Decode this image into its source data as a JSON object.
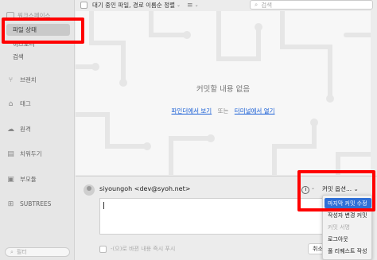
{
  "sidebar": {
    "workspace_label": "워크스페이스",
    "items": [
      {
        "label": "파일 상태",
        "active": true
      },
      {
        "label": "히스토리",
        "active": false
      },
      {
        "label": "검색",
        "active": false
      }
    ],
    "groups": [
      {
        "label": "브랜치",
        "icon": "branch-icon"
      },
      {
        "label": "태그",
        "icon": "tag-icon"
      },
      {
        "label": "원격",
        "icon": "cloud-icon"
      },
      {
        "label": "치워두기",
        "icon": "stash-icon"
      },
      {
        "label": "부모듈",
        "icon": "submodule-icon"
      },
      {
        "label": "SUBTREES",
        "icon": "subtree-icon"
      }
    ],
    "filter_placeholder": "필터"
  },
  "toolbar": {
    "sort_label": "대기 중인 파일, 경로 이름순 정렬",
    "search_placeholder": "검색"
  },
  "main": {
    "empty_title": "커밋할 내용 없음",
    "show_in_finder": "파인더에서 보기",
    "or_text": "또는",
    "open_in_terminal": "터미널에서 열기"
  },
  "commit": {
    "author": "siyoungoh <dev@syoh.net>",
    "message_value": "",
    "commit_options_label": "커밋 옵션...",
    "push_option_label": "-(으)로 바뀐 내용 즉시 푸시",
    "cancel_label": "취소"
  },
  "commit_menu": {
    "items": [
      {
        "label": "마지막 커밋 수정",
        "state": "selected"
      },
      {
        "label": "작성자 변경 커밋",
        "state": "normal"
      },
      {
        "label": "커밋 서명",
        "state": "disabled"
      },
      {
        "label": "로그아웃",
        "state": "normal"
      },
      {
        "label": "풀 리퀘스트 작성",
        "state": "normal"
      }
    ]
  },
  "colors": {
    "highlight": "#ff0000",
    "link": "#1a5fd6",
    "menu_selected": "#2f6fd6"
  }
}
